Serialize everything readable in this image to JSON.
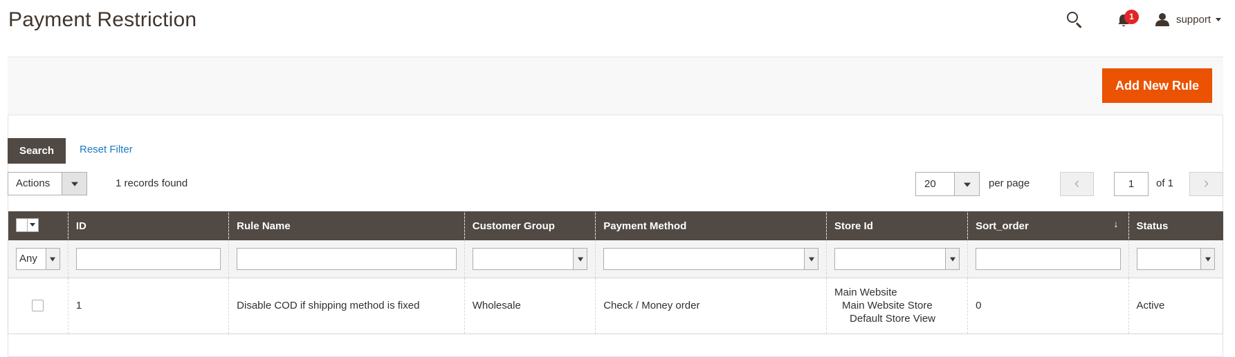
{
  "page": {
    "title": "Payment Restriction"
  },
  "header": {
    "notification_count": "1",
    "user_name": "support"
  },
  "toolbar": {
    "add_new_rule_label": "Add New Rule",
    "search_label": "Search",
    "reset_filter_label": "Reset Filter",
    "actions_label": "Actions",
    "records_found": "1 records found",
    "per_page_value": "20",
    "per_page_label": "per page",
    "current_page": "1",
    "total_pages_label": "of 1"
  },
  "grid": {
    "columns": [
      "ID",
      "Rule Name",
      "Customer Group",
      "Payment Method",
      "Store Id",
      "Sort_order",
      "Status"
    ],
    "sort_indicator": "↓",
    "filters": {
      "mass_action": "Any"
    },
    "rows": [
      {
        "id": "1",
        "rule_name": "Disable COD if shipping method is fixed",
        "customer_group": "Wholesale",
        "payment_method": "Check / Money order",
        "store_lines": [
          "Main Website",
          "Main Website Store",
          "Default Store View"
        ],
        "sort_order": "0",
        "status": "Active"
      }
    ]
  },
  "colors": {
    "accent": "#eb5202",
    "header_dark": "#514943",
    "link": "#1979c3",
    "badge": "#e22626"
  },
  "icons": [
    "search-icon",
    "bell-icon",
    "user-icon",
    "chevron-down-icon",
    "chevron-left-icon",
    "chevron-right-icon"
  ]
}
